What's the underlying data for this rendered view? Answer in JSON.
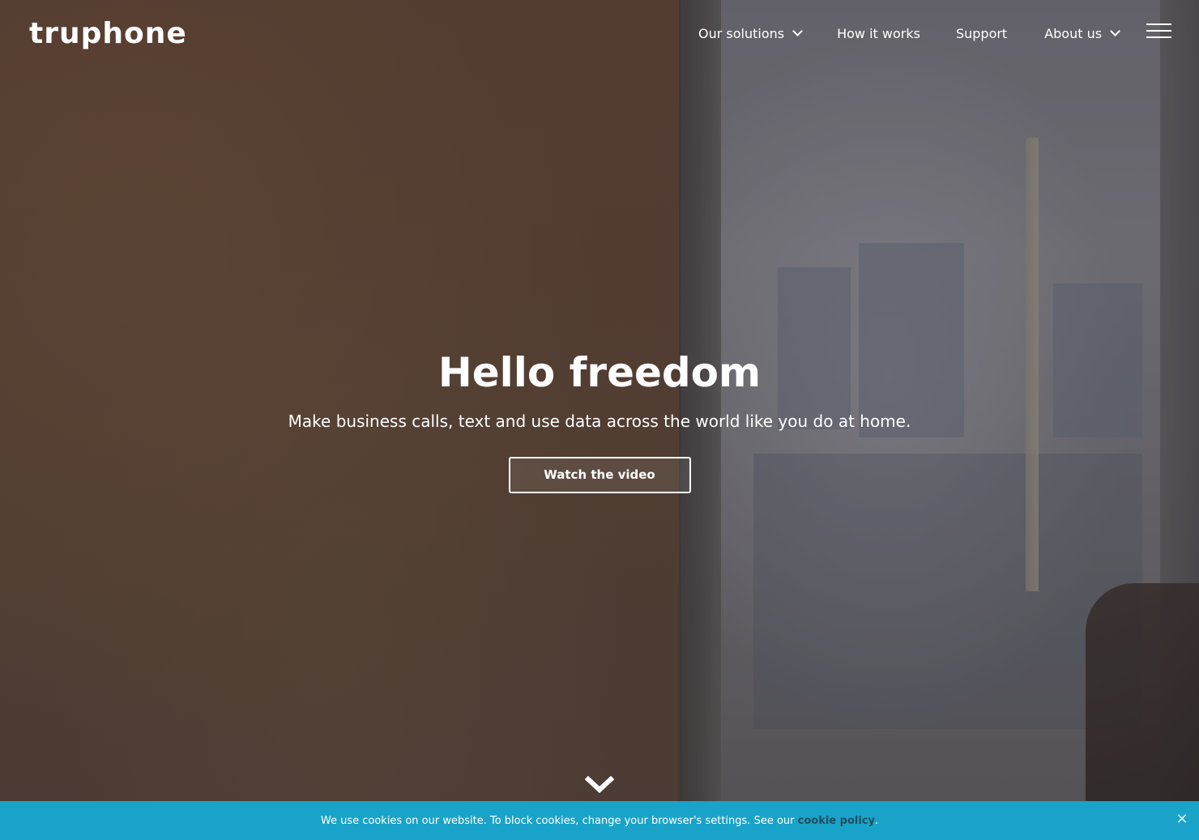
{
  "brand": {
    "logo_text": "truphone"
  },
  "nav": {
    "items": [
      {
        "label": "Our solutions",
        "has_dropdown": true
      },
      {
        "label": "How it works",
        "has_dropdown": false
      },
      {
        "label": "Support",
        "has_dropdown": false
      },
      {
        "label": "About us",
        "has_dropdown": true
      }
    ],
    "menu_icon": "hamburger-icon"
  },
  "hero": {
    "title": "Hello freedom",
    "subtitle": "Make business calls, text and use data across the world like you do at home.",
    "cta_label": "Watch the video",
    "scroll_icon": "chevron-down-icon"
  },
  "cookie_bar": {
    "text": "We use cookies on our website. To block cookies, change your browser's settings. See our ",
    "link_label": "cookie policy",
    "suffix": ".",
    "close_icon": "close-icon",
    "background": "#1aa3c8"
  }
}
